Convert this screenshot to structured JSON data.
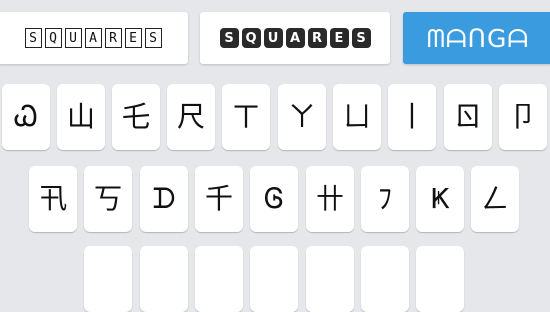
{
  "style_bar": {
    "outline_letters": [
      "S",
      "Q",
      "U",
      "A",
      "R",
      "E",
      "S"
    ],
    "filled_letters": [
      "S",
      "Q",
      "U",
      "A",
      "R",
      "E",
      "S"
    ],
    "active_label": "ᗰᗩᑎGᗩ"
  },
  "keyboard": {
    "row1": [
      "Ꮗ",
      "山",
      "乇",
      "尺",
      "ㄒ",
      "ㄚ",
      "ㄩ",
      "丨",
      "ㄖ",
      "卩"
    ],
    "row2": [
      "卂",
      "丂",
      "ᗪ",
      "千",
      "Ꮆ",
      "卄",
      "ﾌ",
      "Ҝ",
      "ㄥ"
    ]
  },
  "colors": {
    "background": "#e6e7ea",
    "active_button": "#3b9bdf",
    "key_face": "#ffffff"
  }
}
